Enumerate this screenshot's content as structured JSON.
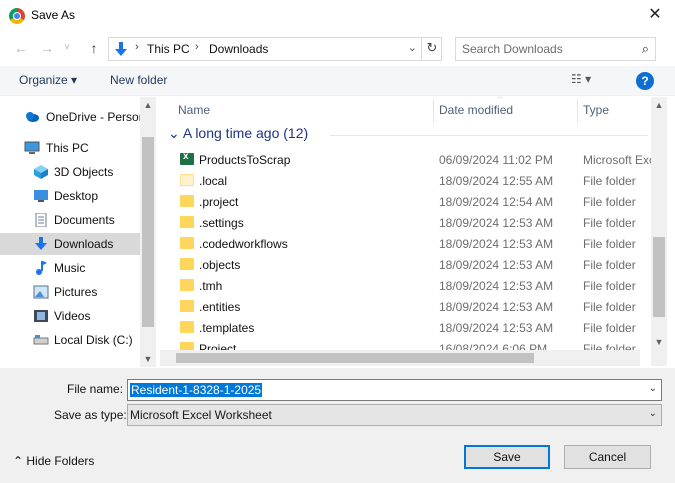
{
  "window": {
    "title": "Save As",
    "close_glyph": "✕",
    "app_icon": "chrome-icon"
  },
  "nav": {
    "back_glyph": "←",
    "forward_glyph": "→",
    "recent_glyph": "˅",
    "up_glyph": "↑",
    "crumbs": [
      "This PC",
      "Downloads"
    ],
    "crumb_sep": "›",
    "dropdown_glyph": "⌄",
    "refresh_glyph": "↻",
    "search_placeholder": "Search Downloads",
    "search_glyph": "⌕"
  },
  "toolbar": {
    "organize_label": "Organize ▾",
    "new_folder_label": "New folder",
    "views_glyph": "☷ ▾",
    "help_glyph": "?"
  },
  "sidebar": {
    "items": [
      {
        "label": "OneDrive - Person",
        "icon": "cloud-icon"
      },
      {
        "label": "This PC",
        "icon": "computer-icon"
      },
      {
        "label": "3D Objects",
        "icon": "cube-icon"
      },
      {
        "label": "Desktop",
        "icon": "desktop-icon"
      },
      {
        "label": "Documents",
        "icon": "document-icon"
      },
      {
        "label": "Downloads",
        "icon": "download-icon",
        "selected": true
      },
      {
        "label": "Music",
        "icon": "music-icon"
      },
      {
        "label": "Pictures",
        "icon": "pictures-icon"
      },
      {
        "label": "Videos",
        "icon": "videos-icon"
      },
      {
        "label": "Local Disk (C:)",
        "icon": "disk-icon"
      }
    ],
    "scroll_up_glyph": "▲",
    "scroll_down_glyph": "▼"
  },
  "files": {
    "columns": {
      "name": "Name",
      "date": "Date modified",
      "type": "Type"
    },
    "sort_glyph": "⌃",
    "group_label": "A long time ago (12)",
    "group_glyph": "⌄",
    "rows": [
      {
        "name": "ProductsToScrap",
        "date": "06/09/2024 11:02 PM",
        "type": "Microsoft Excel",
        "icon": "excel-file-icon"
      },
      {
        "name": ".local",
        "date": "18/09/2024 12:55 AM",
        "type": "File folder",
        "icon": "folder-icon"
      },
      {
        "name": ".project",
        "date": "18/09/2024 12:54 AM",
        "type": "File folder",
        "icon": "folder-icon"
      },
      {
        "name": ".settings",
        "date": "18/09/2024 12:53 AM",
        "type": "File folder",
        "icon": "folder-icon"
      },
      {
        "name": ".codedworkflows",
        "date": "18/09/2024 12:53 AM",
        "type": "File folder",
        "icon": "folder-icon"
      },
      {
        "name": ".objects",
        "date": "18/09/2024 12:53 AM",
        "type": "File folder",
        "icon": "folder-icon"
      },
      {
        "name": ".tmh",
        "date": "18/09/2024 12:53 AM",
        "type": "File folder",
        "icon": "folder-icon"
      },
      {
        "name": ".entities",
        "date": "18/09/2024 12:53 AM",
        "type": "File folder",
        "icon": "folder-icon"
      },
      {
        "name": ".templates",
        "date": "18/09/2024 12:53 AM",
        "type": "File folder",
        "icon": "folder-icon"
      },
      {
        "name": "Project",
        "date": "16/08/2024 6:06 PM",
        "type": "File folder",
        "icon": "folder-icon"
      }
    ]
  },
  "form": {
    "filename_label": "File name:",
    "filename_value": "Resident-1-8328-1-2025",
    "savetype_label": "Save as type:",
    "savetype_value": "Microsoft Excel Worksheet",
    "dropdown_glyph": "⌄",
    "hide_folders_label": "⌃  Hide Folders",
    "save_label": "Save",
    "cancel_label": "Cancel"
  },
  "colors": {
    "accent": "#0078d7",
    "selection": "#d9d9d9",
    "group_header": "#1e3287",
    "folder": "#ffd65c",
    "excel": "#1e7145"
  }
}
